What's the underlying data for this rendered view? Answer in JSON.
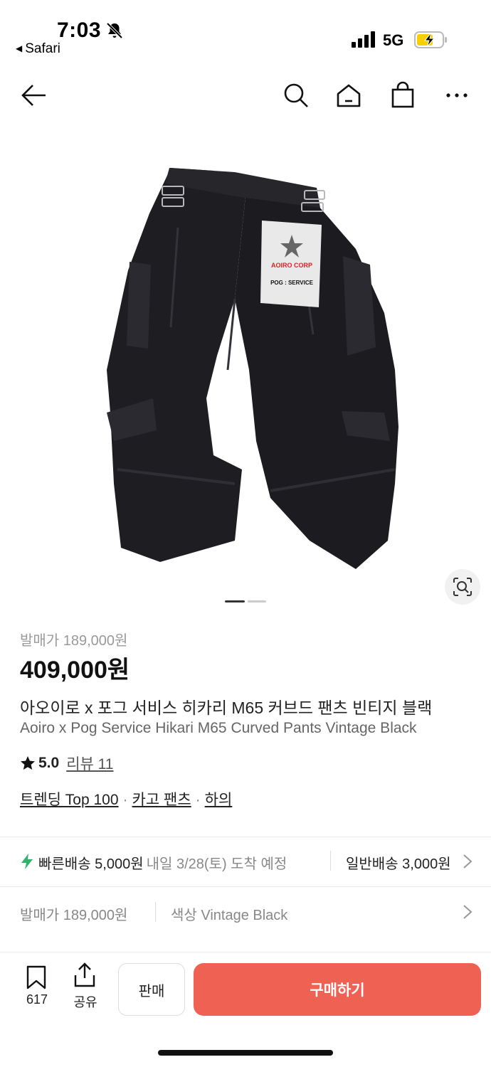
{
  "status_bar": {
    "time": "7:03",
    "back_app": "Safari",
    "network": "5G"
  },
  "nav": {
    "icons": [
      "back-arrow-icon",
      "search-icon",
      "home-icon",
      "cart-icon",
      "more-icon"
    ]
  },
  "image": {
    "patch_brand": "AOIRO CORP",
    "patch_sub": "POG : SERVICE",
    "pager_total": 2,
    "pager_current": 1
  },
  "product": {
    "release_price_label": "발매가 189,000원",
    "price": "409,000원",
    "title_ko": "아오이로 x 포그 서비스 히카리 M65 커브드 팬츠 빈티지 블랙",
    "title_en": "Aoiro x Pog Service Hikari M65 Curved Pants Vintage Black",
    "rating": "5.0",
    "reviews": "리뷰 11",
    "tags": [
      "트렌딩 Top 100",
      "카고 팬츠",
      "하의"
    ]
  },
  "shipping": {
    "fast_label": "빠른배송 5,000원",
    "fast_eta": "내일 3/28(토) 도착 예정",
    "normal_label": "일반배송 3,000원"
  },
  "options": {
    "release_price": "발매가 189,000원",
    "color": "색상 Vintage Black"
  },
  "bottom_bar": {
    "bookmark_count": "617",
    "share_label": "공유",
    "sell_label": "판매",
    "buy_label": "구매하기"
  },
  "colors": {
    "accent": "#ef6253",
    "fast_ship": "#31b46a"
  }
}
